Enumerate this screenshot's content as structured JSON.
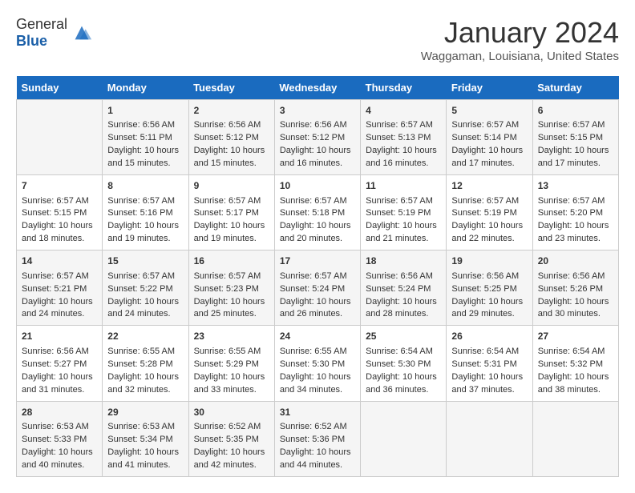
{
  "header": {
    "logo_general": "General",
    "logo_blue": "Blue",
    "title": "January 2024",
    "subtitle": "Waggaman, Louisiana, United States"
  },
  "calendar": {
    "days_of_week": [
      "Sunday",
      "Monday",
      "Tuesday",
      "Wednesday",
      "Thursday",
      "Friday",
      "Saturday"
    ],
    "weeks": [
      [
        {
          "day": "",
          "lines": []
        },
        {
          "day": "1",
          "lines": [
            "Sunrise: 6:56 AM",
            "Sunset: 5:11 PM",
            "Daylight: 10 hours",
            "and 15 minutes."
          ]
        },
        {
          "day": "2",
          "lines": [
            "Sunrise: 6:56 AM",
            "Sunset: 5:12 PM",
            "Daylight: 10 hours",
            "and 15 minutes."
          ]
        },
        {
          "day": "3",
          "lines": [
            "Sunrise: 6:56 AM",
            "Sunset: 5:12 PM",
            "Daylight: 10 hours",
            "and 16 minutes."
          ]
        },
        {
          "day": "4",
          "lines": [
            "Sunrise: 6:57 AM",
            "Sunset: 5:13 PM",
            "Daylight: 10 hours",
            "and 16 minutes."
          ]
        },
        {
          "day": "5",
          "lines": [
            "Sunrise: 6:57 AM",
            "Sunset: 5:14 PM",
            "Daylight: 10 hours",
            "and 17 minutes."
          ]
        },
        {
          "day": "6",
          "lines": [
            "Sunrise: 6:57 AM",
            "Sunset: 5:15 PM",
            "Daylight: 10 hours",
            "and 17 minutes."
          ]
        }
      ],
      [
        {
          "day": "7",
          "lines": [
            "Sunrise: 6:57 AM",
            "Sunset: 5:15 PM",
            "Daylight: 10 hours",
            "and 18 minutes."
          ]
        },
        {
          "day": "8",
          "lines": [
            "Sunrise: 6:57 AM",
            "Sunset: 5:16 PM",
            "Daylight: 10 hours",
            "and 19 minutes."
          ]
        },
        {
          "day": "9",
          "lines": [
            "Sunrise: 6:57 AM",
            "Sunset: 5:17 PM",
            "Daylight: 10 hours",
            "and 19 minutes."
          ]
        },
        {
          "day": "10",
          "lines": [
            "Sunrise: 6:57 AM",
            "Sunset: 5:18 PM",
            "Daylight: 10 hours",
            "and 20 minutes."
          ]
        },
        {
          "day": "11",
          "lines": [
            "Sunrise: 6:57 AM",
            "Sunset: 5:19 PM",
            "Daylight: 10 hours",
            "and 21 minutes."
          ]
        },
        {
          "day": "12",
          "lines": [
            "Sunrise: 6:57 AM",
            "Sunset: 5:19 PM",
            "Daylight: 10 hours",
            "and 22 minutes."
          ]
        },
        {
          "day": "13",
          "lines": [
            "Sunrise: 6:57 AM",
            "Sunset: 5:20 PM",
            "Daylight: 10 hours",
            "and 23 minutes."
          ]
        }
      ],
      [
        {
          "day": "14",
          "lines": [
            "Sunrise: 6:57 AM",
            "Sunset: 5:21 PM",
            "Daylight: 10 hours",
            "and 24 minutes."
          ]
        },
        {
          "day": "15",
          "lines": [
            "Sunrise: 6:57 AM",
            "Sunset: 5:22 PM",
            "Daylight: 10 hours",
            "and 24 minutes."
          ]
        },
        {
          "day": "16",
          "lines": [
            "Sunrise: 6:57 AM",
            "Sunset: 5:23 PM",
            "Daylight: 10 hours",
            "and 25 minutes."
          ]
        },
        {
          "day": "17",
          "lines": [
            "Sunrise: 6:57 AM",
            "Sunset: 5:24 PM",
            "Daylight: 10 hours",
            "and 26 minutes."
          ]
        },
        {
          "day": "18",
          "lines": [
            "Sunrise: 6:56 AM",
            "Sunset: 5:24 PM",
            "Daylight: 10 hours",
            "and 28 minutes."
          ]
        },
        {
          "day": "19",
          "lines": [
            "Sunrise: 6:56 AM",
            "Sunset: 5:25 PM",
            "Daylight: 10 hours",
            "and 29 minutes."
          ]
        },
        {
          "day": "20",
          "lines": [
            "Sunrise: 6:56 AM",
            "Sunset: 5:26 PM",
            "Daylight: 10 hours",
            "and 30 minutes."
          ]
        }
      ],
      [
        {
          "day": "21",
          "lines": [
            "Sunrise: 6:56 AM",
            "Sunset: 5:27 PM",
            "Daylight: 10 hours",
            "and 31 minutes."
          ]
        },
        {
          "day": "22",
          "lines": [
            "Sunrise: 6:55 AM",
            "Sunset: 5:28 PM",
            "Daylight: 10 hours",
            "and 32 minutes."
          ]
        },
        {
          "day": "23",
          "lines": [
            "Sunrise: 6:55 AM",
            "Sunset: 5:29 PM",
            "Daylight: 10 hours",
            "and 33 minutes."
          ]
        },
        {
          "day": "24",
          "lines": [
            "Sunrise: 6:55 AM",
            "Sunset: 5:30 PM",
            "Daylight: 10 hours",
            "and 34 minutes."
          ]
        },
        {
          "day": "25",
          "lines": [
            "Sunrise: 6:54 AM",
            "Sunset: 5:30 PM",
            "Daylight: 10 hours",
            "and 36 minutes."
          ]
        },
        {
          "day": "26",
          "lines": [
            "Sunrise: 6:54 AM",
            "Sunset: 5:31 PM",
            "Daylight: 10 hours",
            "and 37 minutes."
          ]
        },
        {
          "day": "27",
          "lines": [
            "Sunrise: 6:54 AM",
            "Sunset: 5:32 PM",
            "Daylight: 10 hours",
            "and 38 minutes."
          ]
        }
      ],
      [
        {
          "day": "28",
          "lines": [
            "Sunrise: 6:53 AM",
            "Sunset: 5:33 PM",
            "Daylight: 10 hours",
            "and 40 minutes."
          ]
        },
        {
          "day": "29",
          "lines": [
            "Sunrise: 6:53 AM",
            "Sunset: 5:34 PM",
            "Daylight: 10 hours",
            "and 41 minutes."
          ]
        },
        {
          "day": "30",
          "lines": [
            "Sunrise: 6:52 AM",
            "Sunset: 5:35 PM",
            "Daylight: 10 hours",
            "and 42 minutes."
          ]
        },
        {
          "day": "31",
          "lines": [
            "Sunrise: 6:52 AM",
            "Sunset: 5:36 PM",
            "Daylight: 10 hours",
            "and 44 minutes."
          ]
        },
        {
          "day": "",
          "lines": []
        },
        {
          "day": "",
          "lines": []
        },
        {
          "day": "",
          "lines": []
        }
      ]
    ]
  }
}
